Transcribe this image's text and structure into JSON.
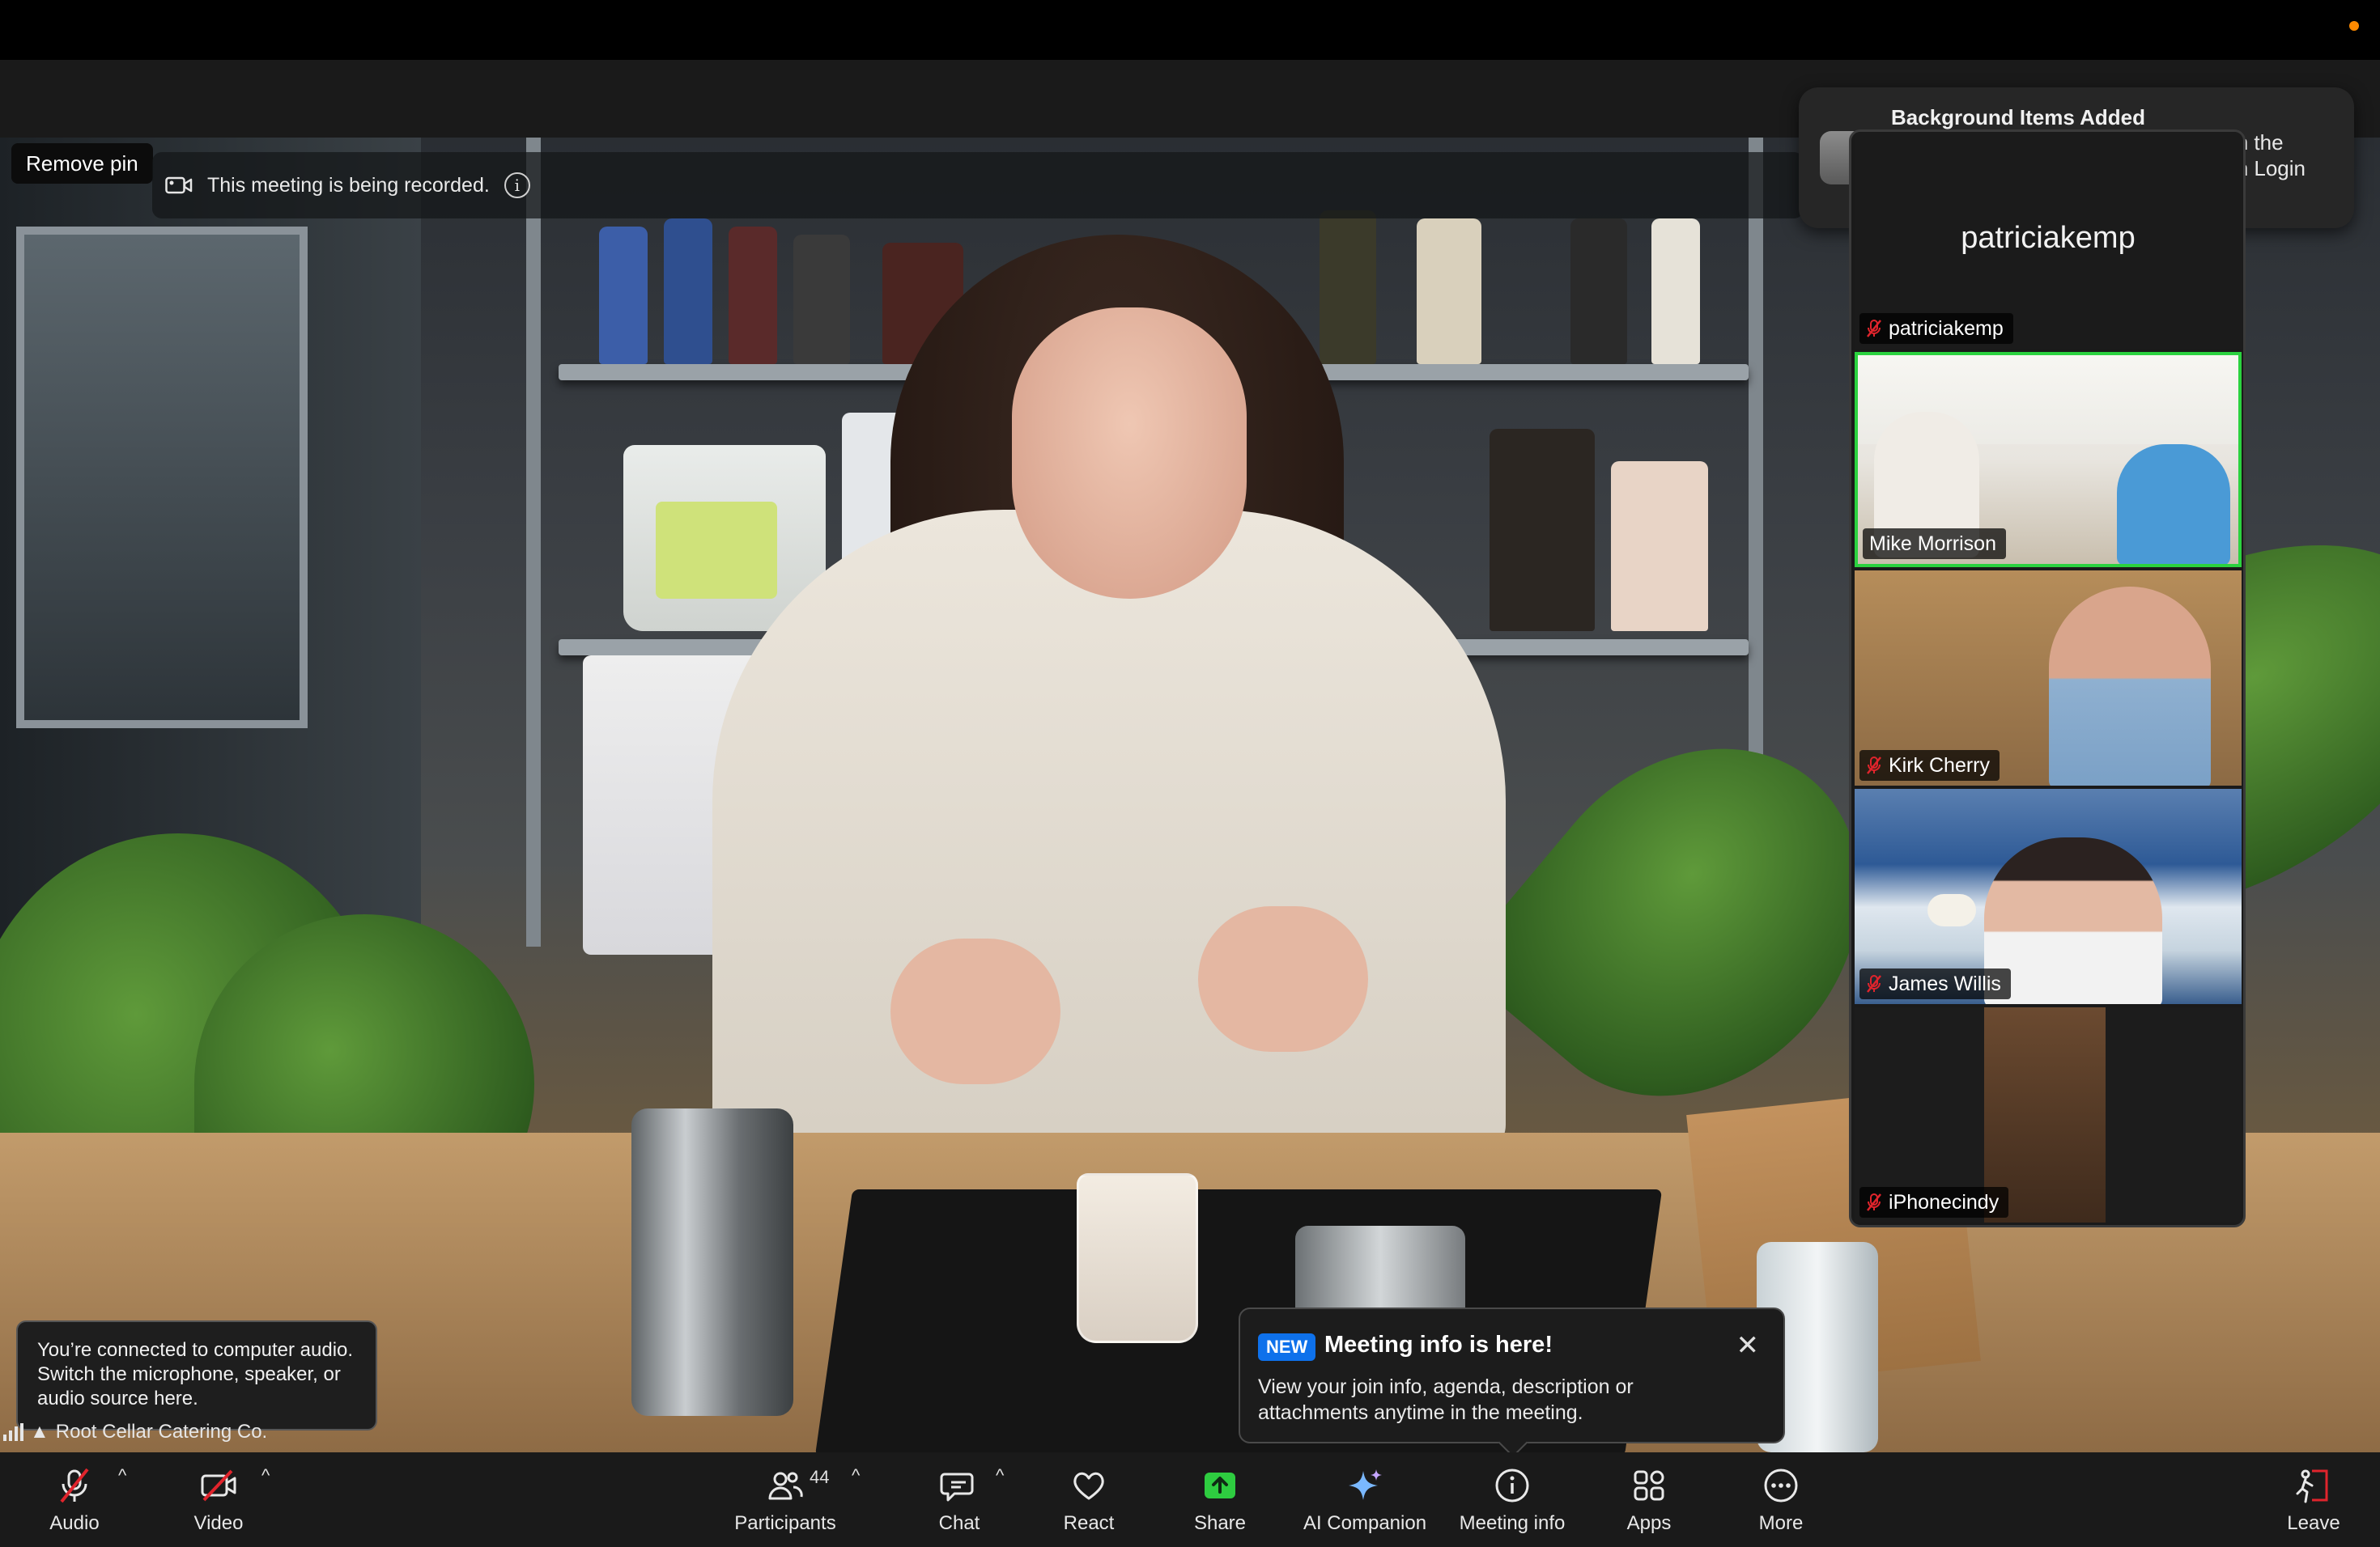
{
  "window": {
    "status_dot_color": "#ff8a00"
  },
  "pin": {
    "label": "Remove pin"
  },
  "recording": {
    "text": "This meeting is being recorded."
  },
  "bg_notification": {
    "title": "Background Items Added",
    "body_line1": "in the",
    "body_line2": "in Login"
  },
  "participants_panel": {
    "top_tile_center_name": "patriciakemp",
    "tiles": [
      {
        "name": "patriciakemp",
        "muted": true,
        "active": false
      },
      {
        "name": "Mike Morrison",
        "muted": false,
        "active": true
      },
      {
        "name": "Kirk Cherry",
        "muted": true,
        "active": false
      },
      {
        "name": "James Willis",
        "muted": true,
        "active": false
      },
      {
        "name": "iPhonecindy",
        "muted": true,
        "active": false
      }
    ]
  },
  "audio_toast": {
    "text": "You’re connected to computer audio. Switch the microphone, speaker, or audio source here."
  },
  "org_label": {
    "text": "Root Cellar Catering Co."
  },
  "meeting_info_toast": {
    "badge": "NEW",
    "title": "Meeting info is here!",
    "body": "View your join info, agenda, description or attachments anytime in the meeting."
  },
  "toolbar": {
    "audio": "Audio",
    "video": "Video",
    "participants": "Participants",
    "participants_count": "44",
    "chat": "Chat",
    "react": "React",
    "share": "Share",
    "ai_companion": "AI Companion",
    "meeting_info": "Meeting info",
    "apps": "Apps",
    "more": "More",
    "leave": "Leave"
  },
  "colors": {
    "active_speaker_border": "#2bd23f",
    "share_green": "#2ecc40",
    "muted_red": "#e0242c",
    "new_badge_blue": "#0e71eb",
    "toolbar_bg": "#1a1a1a"
  }
}
